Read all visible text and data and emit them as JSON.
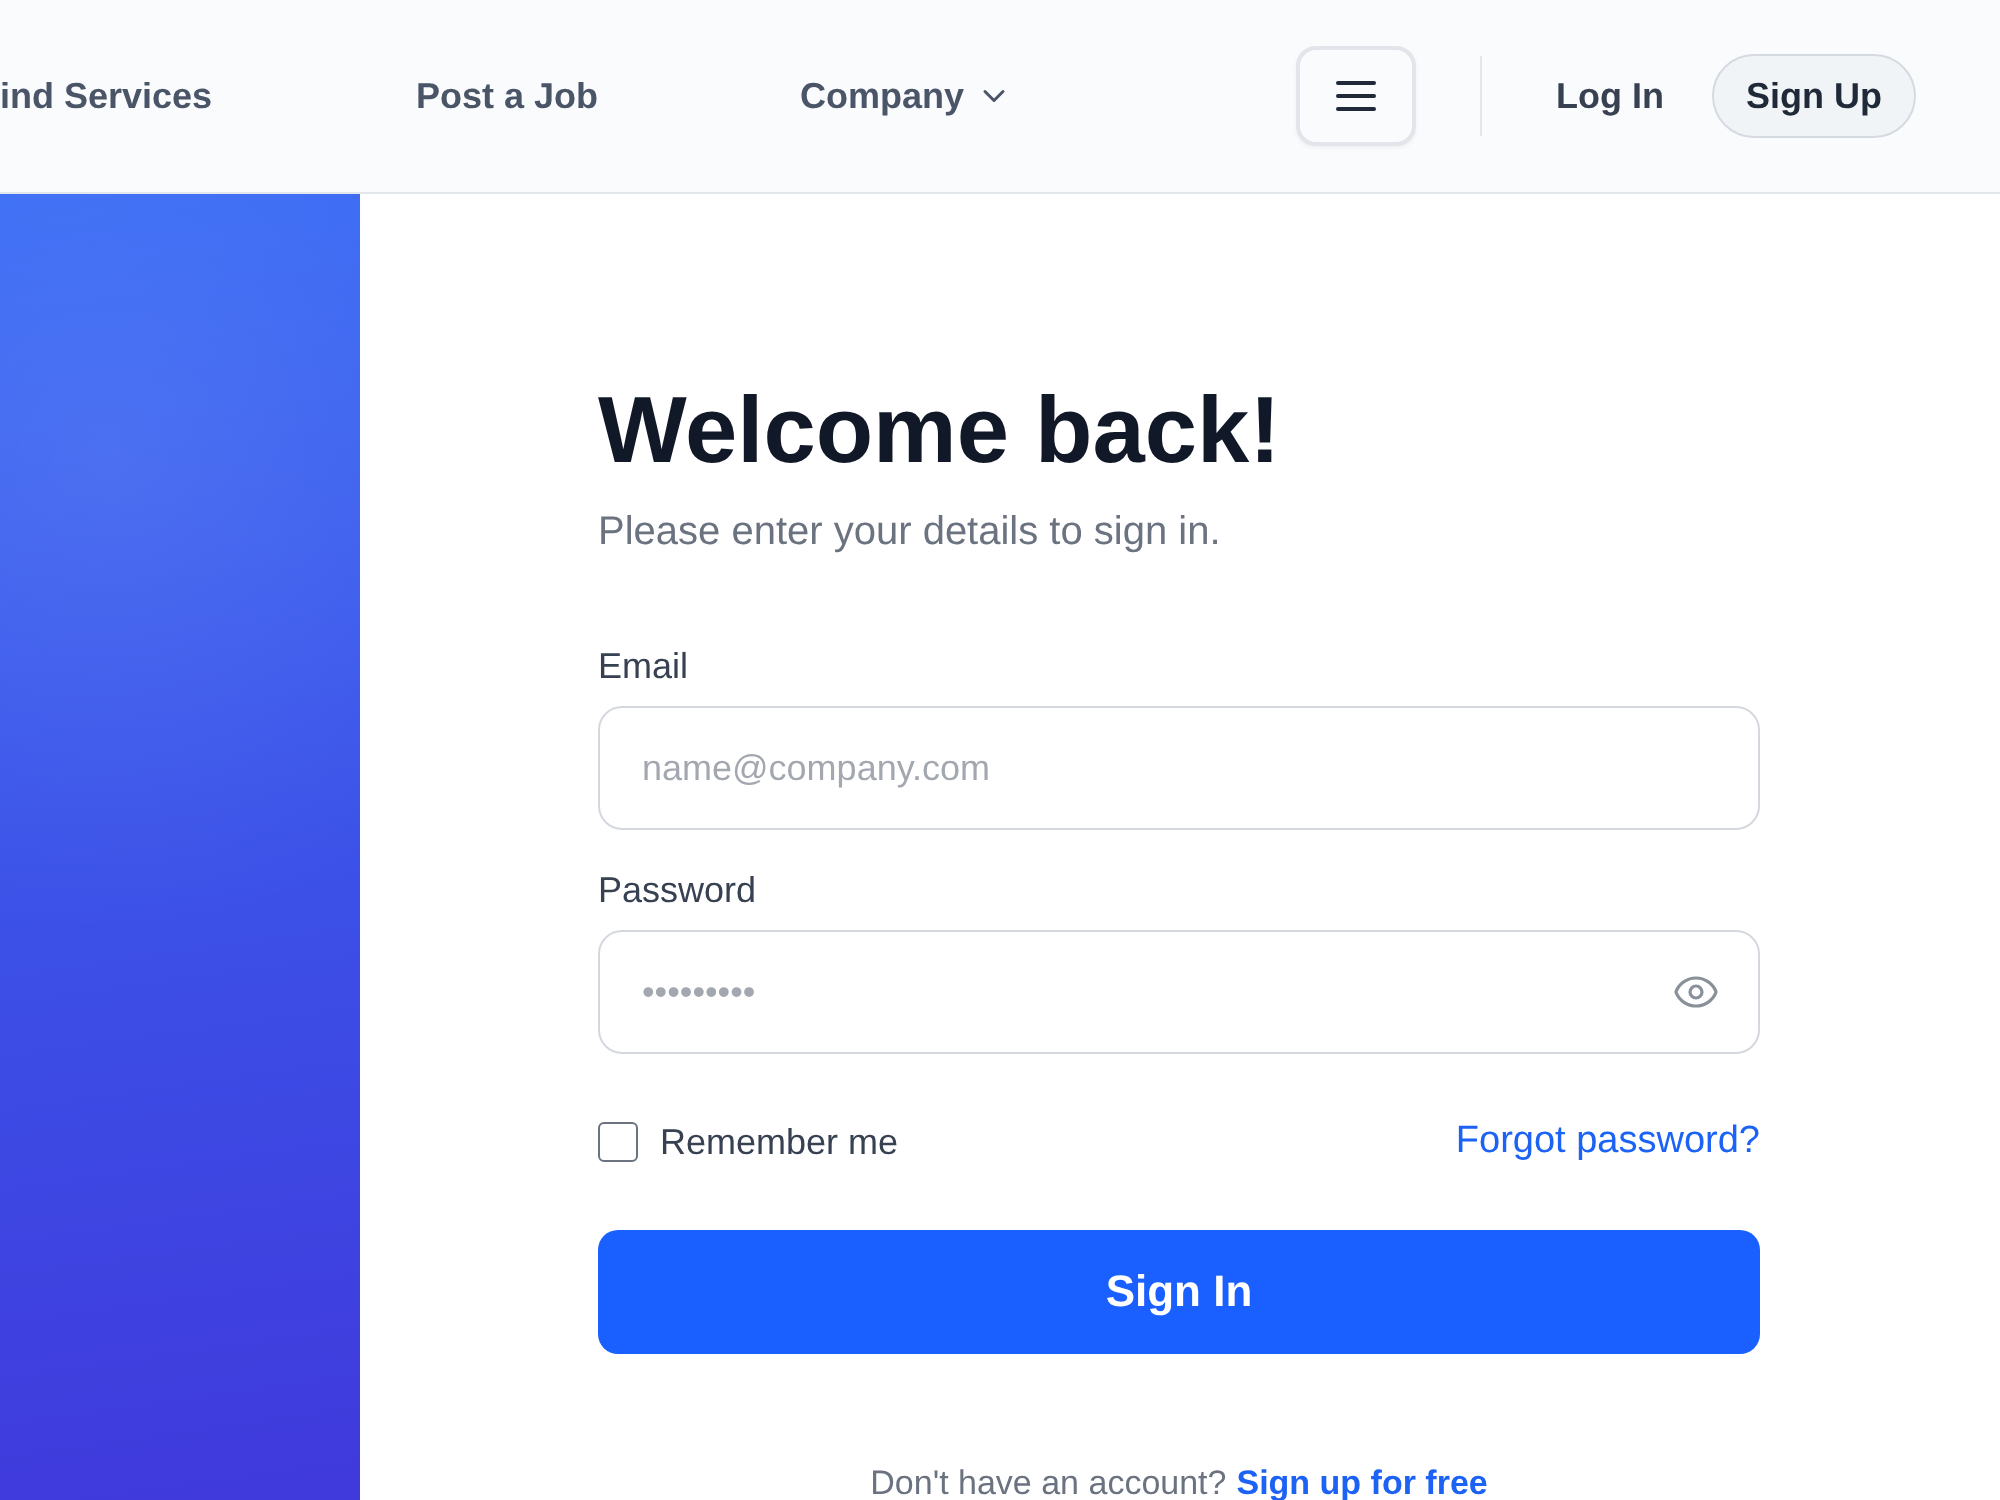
{
  "nav": {
    "links": [
      {
        "label": "ind Services",
        "dropdown": false
      },
      {
        "label": "Post a Job",
        "dropdown": false
      },
      {
        "label": "Company",
        "dropdown": true
      }
    ],
    "login": "Log In",
    "signup": "Sign Up"
  },
  "form": {
    "title": "Welcome back!",
    "subtitle": "Please enter your details to sign in.",
    "fields": [
      {
        "kind": "email",
        "label": "Email",
        "placeholder": "name@company.com"
      },
      {
        "kind": "password",
        "label": "Password",
        "placeholder": "•••••••••"
      }
    ],
    "remember": {
      "label": "Remember me",
      "checked": false
    },
    "forgot": "Forgot password?",
    "submit": "Sign In",
    "footer": {
      "text": "Don't have an account?",
      "link": "Sign up for free"
    }
  }
}
